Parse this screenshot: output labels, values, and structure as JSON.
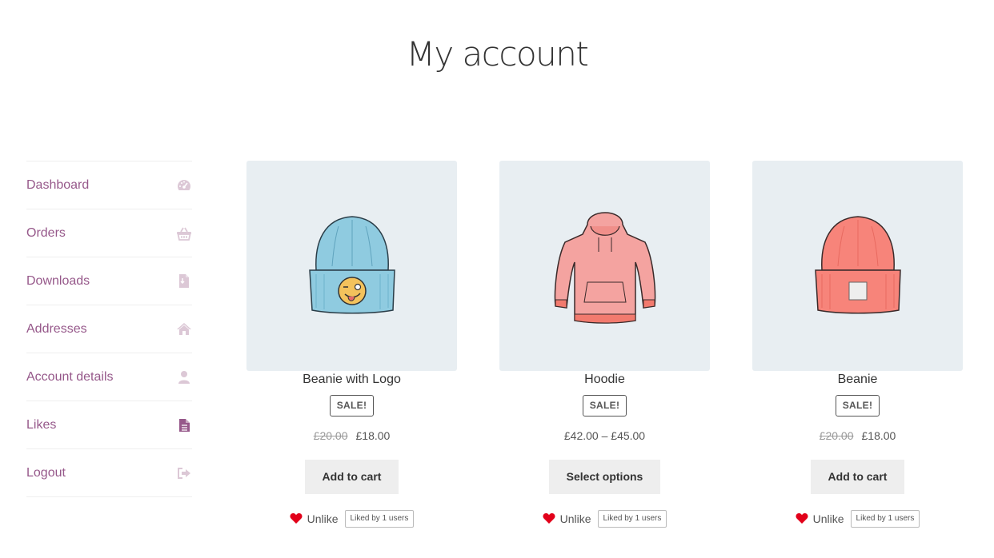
{
  "page": {
    "title": "My account"
  },
  "nav": {
    "items": [
      {
        "label": "Dashboard",
        "icon": "dashboard-icon"
      },
      {
        "label": "Orders",
        "icon": "basket-icon"
      },
      {
        "label": "Downloads",
        "icon": "download-file-icon"
      },
      {
        "label": "Addresses",
        "icon": "home-icon"
      },
      {
        "label": "Account details",
        "icon": "user-icon"
      },
      {
        "label": "Likes",
        "icon": "file-text-icon",
        "active": true
      },
      {
        "label": "Logout",
        "icon": "sign-out-icon"
      }
    ],
    "color": "#96588a",
    "icon_color": "#dcc8d6",
    "active_icon_color": "#96588a"
  },
  "products": [
    {
      "title": "Beanie with Logo",
      "badge": "SALE!",
      "price_old": "£20.00",
      "price": "£18.00",
      "button": "Add to cart",
      "like_label": "Unlike",
      "liked_by": "Liked by 1 users",
      "image": "blue-beanie-with-logo"
    },
    {
      "title": "Hoodie",
      "badge": "SALE!",
      "price_old": "",
      "price": "£42.00 – £45.00",
      "button": "Select options",
      "like_label": "Unlike",
      "liked_by": "Liked by 1 users",
      "image": "pink-hoodie"
    },
    {
      "title": "Beanie",
      "badge": "SALE!",
      "price_old": "£20.00",
      "price": "£18.00",
      "button": "Add to cart",
      "like_label": "Unlike",
      "liked_by": "Liked by 1 users",
      "image": "pink-beanie"
    }
  ],
  "colors": {
    "heart": "#e2001a",
    "image_bg": "#e8eef2"
  }
}
